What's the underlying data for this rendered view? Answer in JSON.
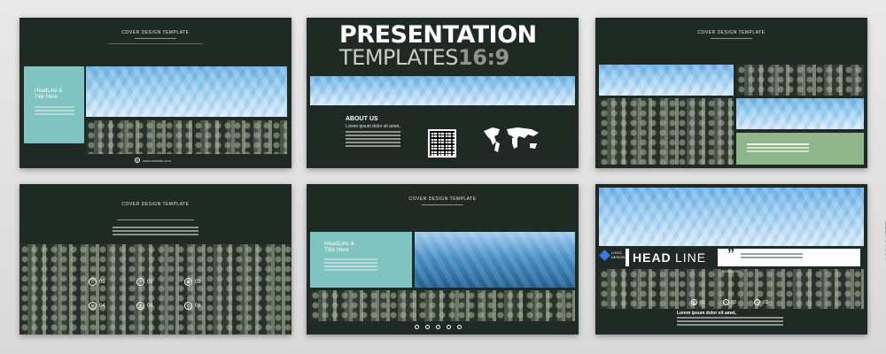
{
  "slides": {
    "s1": {
      "header": "COVER DESIGN TEMPLATE",
      "panel_text": "HeadLine &\nTitle Here",
      "website": "www.website.com"
    },
    "s2": {
      "title": "PRESENTATION",
      "subtitle": "TEMPLATES",
      "ratio": "16:9",
      "about_title": "ABOUT US",
      "about_sub": "Lorem ipsum dolor sit amet,"
    },
    "s3": {
      "header": "COVER DESIGN TEMPLATE"
    },
    "s4": {
      "header": "COVER DESIGN TEMPLATE",
      "icons": [
        {
          "num": "01",
          "icon": "home-icon"
        },
        {
          "num": "02",
          "icon": "clock-icon"
        },
        {
          "num": "03",
          "icon": "camera-icon"
        },
        {
          "num": "04",
          "icon": "location-pin-icon"
        },
        {
          "num": "05",
          "icon": "bar-chart-icon"
        },
        {
          "num": "06",
          "icon": "phone-icon"
        }
      ]
    },
    "s5": {
      "header": "COVER DESIGN TEMPLATE",
      "panel_text": "HeadLine &\nTitle Here"
    },
    "s6": {
      "logo_text": "LOGO DESIGN",
      "headline": "HEAD",
      "headline2": "LINE",
      "quote_mark": "”",
      "business": "BUSINESS",
      "nums": [
        "01",
        "02",
        "03"
      ],
      "body_title": "Lorem ipsum dolor sit amet,"
    }
  },
  "stock_id": "139164577"
}
